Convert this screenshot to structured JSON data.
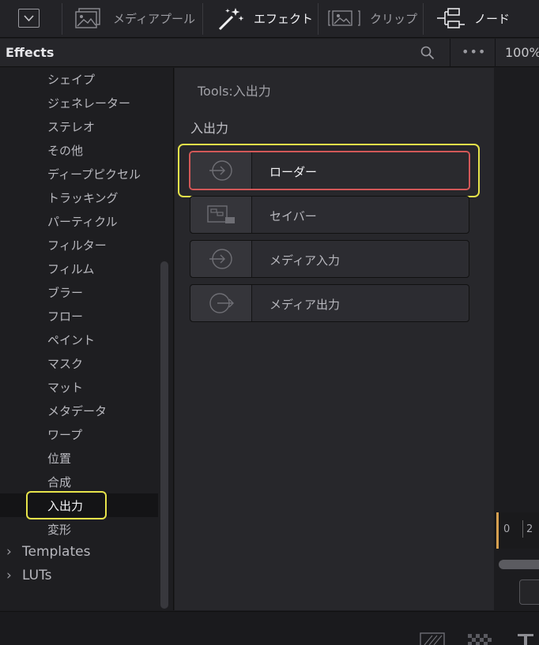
{
  "toolbar": {
    "media_pool_label": "メディアプール",
    "effects_label": "エフェクト",
    "clips_label": "クリップ",
    "nodes_label": "ノード"
  },
  "header": {
    "title": "Effects",
    "more_label": "•••",
    "zoom": "100%"
  },
  "tree": {
    "items": [
      "シェイプ",
      "ジェネレーター",
      "ステレオ",
      "その他",
      "ディープピクセル",
      "トラッキング",
      "パーティクル",
      "フィルター",
      "フィルム",
      "ブラー",
      "フロー",
      "ペイント",
      "マスク",
      "マット",
      "メタデータ",
      "ワープ",
      "位置",
      "合成",
      "入出力",
      "変形"
    ],
    "selected": "入出力",
    "groups": [
      "Templates",
      "LUTs"
    ]
  },
  "middle": {
    "breadcrumb": "Tools:入出力",
    "section": "入出力",
    "tools": [
      "ローダー",
      "セイバー",
      "メディア入力",
      "メディア出力"
    ],
    "selected_tool": "ローダー"
  },
  "right_panel": {
    "ruler_0": "0",
    "ruler_2": "2"
  },
  "colors": {
    "highlight_yellow": "#e6e34a",
    "highlight_red": "#d35858",
    "playhead": "#d6a050"
  }
}
